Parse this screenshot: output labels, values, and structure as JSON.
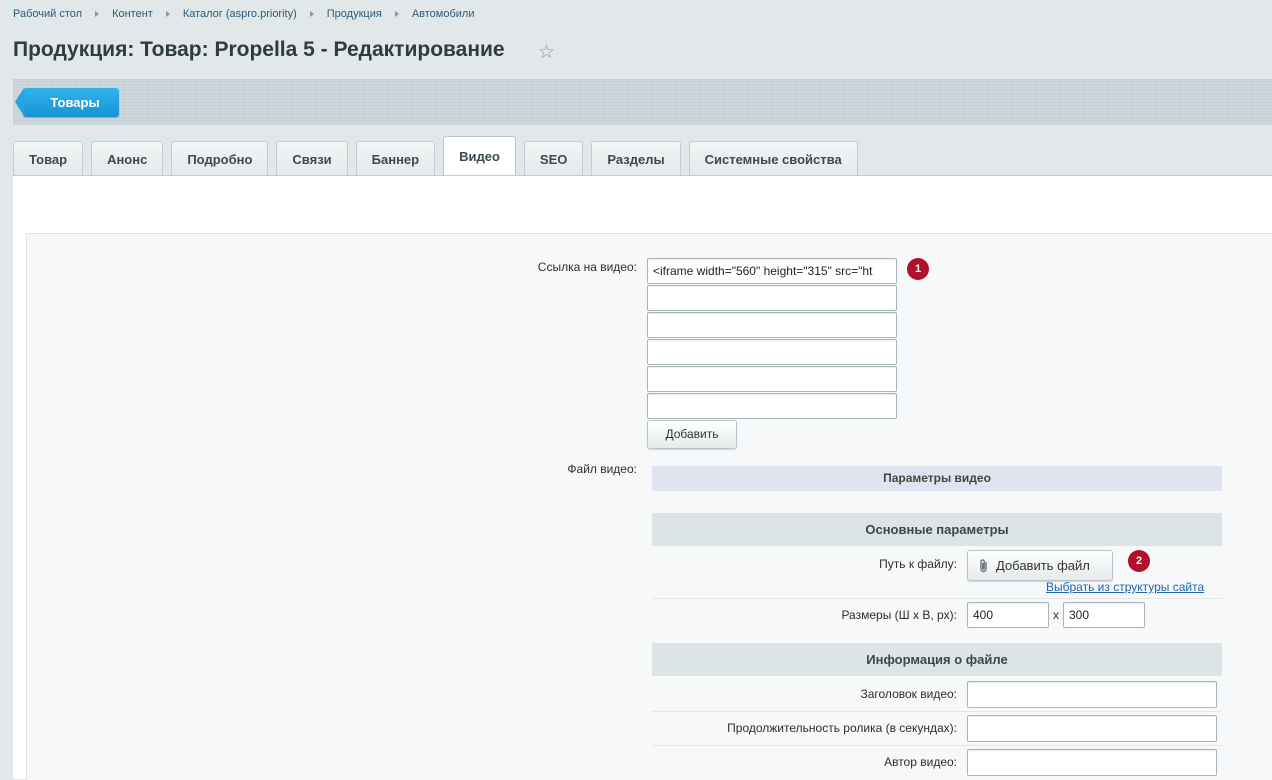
{
  "breadcrumbs": [
    "Рабочий стол",
    "Контент",
    "Каталог (aspro.priority)",
    "Продукция",
    "Автомобили"
  ],
  "title": "Продукция: Товар: Propella 5 - Редактирование",
  "toolbar": {
    "back_label": "Товары"
  },
  "tabs": [
    {
      "label": "Товар"
    },
    {
      "label": "Анонс"
    },
    {
      "label": "Подробно"
    },
    {
      "label": "Связи"
    },
    {
      "label": "Баннер"
    },
    {
      "label": "Видео",
      "active": true
    },
    {
      "label": "SEO"
    },
    {
      "label": "Разделы"
    },
    {
      "label": "Системные свойства"
    }
  ],
  "video_link": {
    "label": "Ссылка на видео:",
    "values": [
      "<iframe width=\"560\" height=\"315\" src=\"ht",
      "",
      "",
      "",
      "",
      ""
    ],
    "add_label": "Добавить",
    "marker": "1"
  },
  "video_file": {
    "label": "Файл видео:",
    "params_title": "Параметры видео",
    "main_section": "Основные параметры",
    "path_label": "Путь к файлу:",
    "add_file_label": "Добавить файл",
    "marker": "2",
    "site_link": "Выбрать из структуры сайта",
    "size_label": "Размеры (Ш х В, px):",
    "width": "400",
    "x_sep": "x",
    "height": "300",
    "info_section": "Информация о файле",
    "title_label": "Заголовок видео:",
    "duration_label": "Продолжительность ролика (в секундах):",
    "author_label": "Автор видео:"
  },
  "colors": {
    "accent": "#1a93d4",
    "marker": "#b0102a",
    "link": "#2067b0"
  },
  "icons": {
    "favorite": "star-icon",
    "attach": "paperclip-icon"
  }
}
